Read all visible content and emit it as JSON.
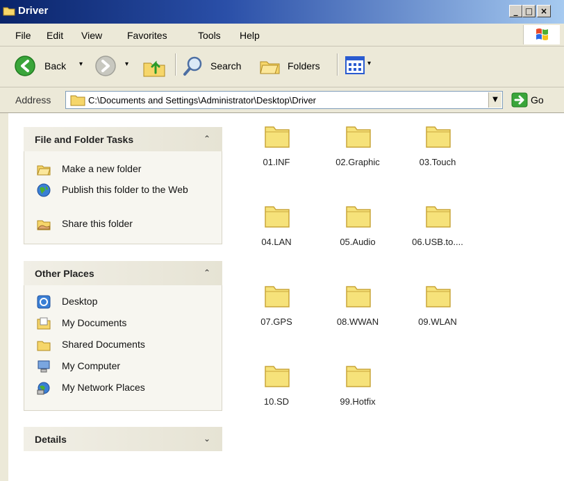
{
  "window": {
    "title": "Driver",
    "minimize": "_",
    "maximize": "□",
    "close": "×"
  },
  "menubar": {
    "items": [
      "File",
      "Edit",
      "View",
      "Favorites",
      "Tools",
      "Help"
    ]
  },
  "toolbar": {
    "back_label": "Back",
    "search_label": "Search",
    "folders_label": "Folders"
  },
  "address": {
    "label": "Address",
    "value": "C:\\Documents and Settings\\Administrator\\Desktop\\Driver",
    "go_label": "Go"
  },
  "panels": {
    "file_tasks": {
      "title": "File and Folder Tasks",
      "items": [
        "Make a new folder",
        "Publish this folder to the Web",
        "Share this folder"
      ]
    },
    "other_places": {
      "title": "Other Places",
      "items": [
        "Desktop",
        "My Documents",
        "Shared Documents",
        "My Computer",
        "My Network Places"
      ]
    },
    "details": {
      "title": "Details"
    }
  },
  "folders": [
    "01.INF",
    "02.Graphic",
    "03.Touch",
    "04.LAN",
    "05.Audio",
    "06.USB.to....",
    "07.GPS",
    "08.WWAN",
    "09.WLAN",
    "10.SD",
    "99.Hotfix"
  ],
  "colors": {
    "title_bar": "#0a246a",
    "folder_fill": "#f6e27a",
    "panel_header": "#e6e3d4"
  }
}
